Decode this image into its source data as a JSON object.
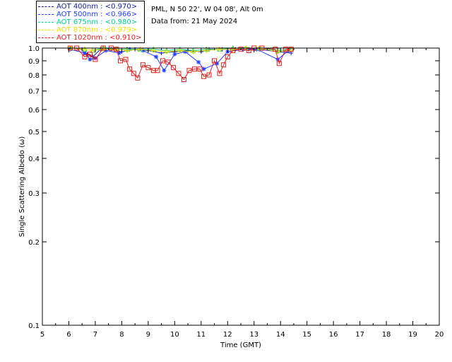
{
  "header": {
    "site_line": "PML, N 50 22', W 04 08', Alt 0m",
    "date_line": "Data from: 21 May 2024"
  },
  "legend": [
    {
      "label": "AOT  400nm : <0.970>",
      "color": "#1a1aa0"
    },
    {
      "label": "AOT  500nm : <0.966>",
      "color": "#1f3cff"
    },
    {
      "label": "AOT  675nm : <0.980>",
      "color": "#00d08a"
    },
    {
      "label": "AOT  870nm : <0.979>",
      "color": "#f2e000"
    },
    {
      "label": "AOT 1020nm : <0.910>",
      "color": "#e02020"
    }
  ],
  "chart_data": {
    "type": "scatter",
    "xlabel": "Time (GMT)",
    "ylabel": "Single Scattering Albedo (ω)",
    "xlim": [
      5,
      20
    ],
    "ylim": [
      0.1,
      1.0
    ],
    "y_scale": "log",
    "x_ticks": [
      "5",
      "6",
      "7",
      "8",
      "9",
      "10",
      "11",
      "12",
      "13",
      "14",
      "15",
      "16",
      "17",
      "18",
      "19",
      "20"
    ],
    "y_ticks": [
      "0.1",
      "0.2",
      "0.3",
      "0.4",
      "0.5",
      "0.6",
      "0.7",
      "0.8",
      "0.9",
      "1.0"
    ],
    "series": [
      {
        "name": "AOT  400nm : <0.970>",
        "color": "#1a1aa0",
        "marker": "plus",
        "points": [
          [
            6.05,
            1.0
          ],
          [
            6.5,
            0.99
          ],
          [
            6.7,
            0.95
          ],
          [
            6.9,
            0.93
          ],
          [
            7.2,
            0.99
          ],
          [
            7.6,
            0.99
          ],
          [
            8.0,
            0.97
          ],
          [
            8.5,
            0.99
          ],
          [
            9.0,
            0.98
          ],
          [
            9.5,
            0.96
          ],
          [
            10.0,
            0.97
          ],
          [
            10.5,
            0.98
          ],
          [
            11.0,
            0.97
          ],
          [
            11.3,
            0.99
          ],
          [
            11.8,
            0.99
          ],
          [
            12.3,
            0.99
          ],
          [
            12.8,
            0.99
          ],
          [
            13.2,
            0.99
          ],
          [
            13.9,
            0.97
          ],
          [
            14.4,
            0.96
          ]
        ]
      },
      {
        "name": "AOT  500nm : <0.966>",
        "color": "#1f3cff",
        "marker": "star",
        "points": [
          [
            6.05,
            0.99
          ],
          [
            6.6,
            0.96
          ],
          [
            6.8,
            0.91
          ],
          [
            7.0,
            0.92
          ],
          [
            7.4,
            0.98
          ],
          [
            7.9,
            0.96
          ],
          [
            8.3,
            0.99
          ],
          [
            8.8,
            0.98
          ],
          [
            9.3,
            0.93
          ],
          [
            9.6,
            0.83
          ],
          [
            10.0,
            0.95
          ],
          [
            10.4,
            0.97
          ],
          [
            10.9,
            0.89
          ],
          [
            11.1,
            0.84
          ],
          [
            11.6,
            0.88
          ],
          [
            12.0,
            0.97
          ],
          [
            12.6,
            0.99
          ],
          [
            13.1,
            0.99
          ],
          [
            13.9,
            0.91
          ],
          [
            14.3,
            0.98
          ]
        ]
      },
      {
        "name": "AOT  675nm : <0.980>",
        "color": "#00d08a",
        "marker": "triangle",
        "points": [
          [
            6.05,
            1.0
          ],
          [
            6.6,
            0.99
          ],
          [
            6.9,
            0.98
          ],
          [
            7.3,
            1.0
          ],
          [
            7.8,
            0.99
          ],
          [
            8.2,
            0.99
          ],
          [
            8.7,
            0.99
          ],
          [
            9.2,
            0.99
          ],
          [
            9.7,
            0.98
          ],
          [
            10.2,
            0.99
          ],
          [
            10.7,
            0.98
          ],
          [
            11.2,
            0.99
          ],
          [
            11.7,
            0.99
          ],
          [
            12.2,
            1.0
          ],
          [
            12.7,
            1.0
          ],
          [
            13.2,
            1.0
          ],
          [
            13.9,
            0.98
          ],
          [
            14.4,
            0.99
          ]
        ]
      },
      {
        "name": "AOT  870nm : <0.979>",
        "color": "#f2e000",
        "marker": "diamond",
        "points": [
          [
            6.05,
            1.0
          ],
          [
            6.6,
            0.99
          ],
          [
            6.9,
            0.98
          ],
          [
            7.3,
            0.99
          ],
          [
            7.8,
            0.99
          ],
          [
            8.2,
            0.98
          ],
          [
            8.7,
            0.99
          ],
          [
            9.2,
            0.98
          ],
          [
            9.7,
            0.97
          ],
          [
            10.2,
            0.98
          ],
          [
            10.7,
            0.97
          ],
          [
            11.2,
            0.98
          ],
          [
            11.7,
            0.99
          ],
          [
            12.2,
            0.99
          ],
          [
            12.7,
            1.0
          ],
          [
            13.2,
            1.0
          ],
          [
            13.9,
            0.97
          ],
          [
            14.4,
            0.99
          ]
        ]
      },
      {
        "name": "AOT 1020nm : <0.910>",
        "color": "#e02020",
        "marker": "square",
        "points": [
          [
            6.05,
            1.0
          ],
          [
            6.3,
            1.0
          ],
          [
            6.6,
            0.93
          ],
          [
            6.8,
            0.95
          ],
          [
            7.0,
            0.91
          ],
          [
            7.3,
            1.0
          ],
          [
            7.6,
            1.0
          ],
          [
            7.8,
            0.99
          ],
          [
            7.95,
            0.9
          ],
          [
            8.15,
            0.91
          ],
          [
            8.3,
            0.84
          ],
          [
            8.45,
            0.81
          ],
          [
            8.6,
            0.78
          ],
          [
            8.8,
            0.87
          ],
          [
            9.0,
            0.85
          ],
          [
            9.2,
            0.83
          ],
          [
            9.35,
            0.83
          ],
          [
            9.55,
            0.9
          ],
          [
            9.75,
            0.89
          ],
          [
            9.95,
            0.85
          ],
          [
            10.15,
            0.81
          ],
          [
            10.35,
            0.77
          ],
          [
            10.55,
            0.83
          ],
          [
            10.75,
            0.84
          ],
          [
            10.95,
            0.84
          ],
          [
            11.1,
            0.79
          ],
          [
            11.3,
            0.8
          ],
          [
            11.5,
            0.9
          ],
          [
            11.7,
            0.81
          ],
          [
            11.85,
            0.87
          ],
          [
            12.0,
            0.93
          ],
          [
            12.2,
            0.98
          ],
          [
            12.5,
            0.99
          ],
          [
            12.8,
            0.98
          ],
          [
            13.0,
            1.0
          ],
          [
            13.3,
            1.0
          ],
          [
            13.8,
            0.99
          ],
          [
            13.95,
            0.88
          ],
          [
            14.2,
            0.99
          ],
          [
            14.4,
            0.99
          ]
        ]
      }
    ]
  }
}
